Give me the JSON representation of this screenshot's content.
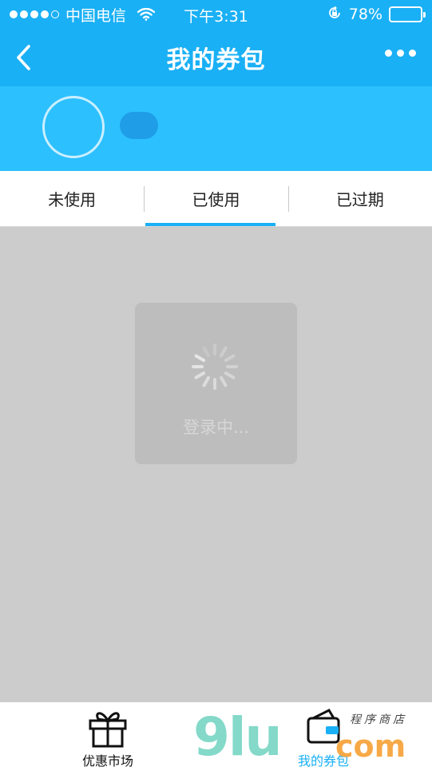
{
  "status_bar": {
    "carrier": "中国电信",
    "time": "下午3:31",
    "battery_percent": "78%",
    "battery_level": 0.78,
    "signal_bars_filled": 4,
    "signal_bars_total": 5
  },
  "nav": {
    "title": "我的券包",
    "back_icon": "chevron-left-icon",
    "more_icon": "more-dots-icon"
  },
  "tabs": [
    {
      "label": "未使用",
      "active": false
    },
    {
      "label": "已使用",
      "active": true
    },
    {
      "label": "已过期",
      "active": false
    }
  ],
  "loading": {
    "text": "登录中...",
    "icon": "spinner-icon"
  },
  "tab_bar": {
    "items": [
      {
        "label": "优惠市场",
        "icon": "gift-icon",
        "active": false
      },
      {
        "label": "我的券包",
        "icon": "wallet-icon",
        "active": true
      }
    ]
  },
  "watermark": {
    "main": "9lu",
    "suffix": "com",
    "tagline": "程序商店"
  },
  "colors": {
    "primary": "#1ab0f5",
    "header_bg": "#2cc0ff",
    "overlay_bg": "#cccccc"
  }
}
